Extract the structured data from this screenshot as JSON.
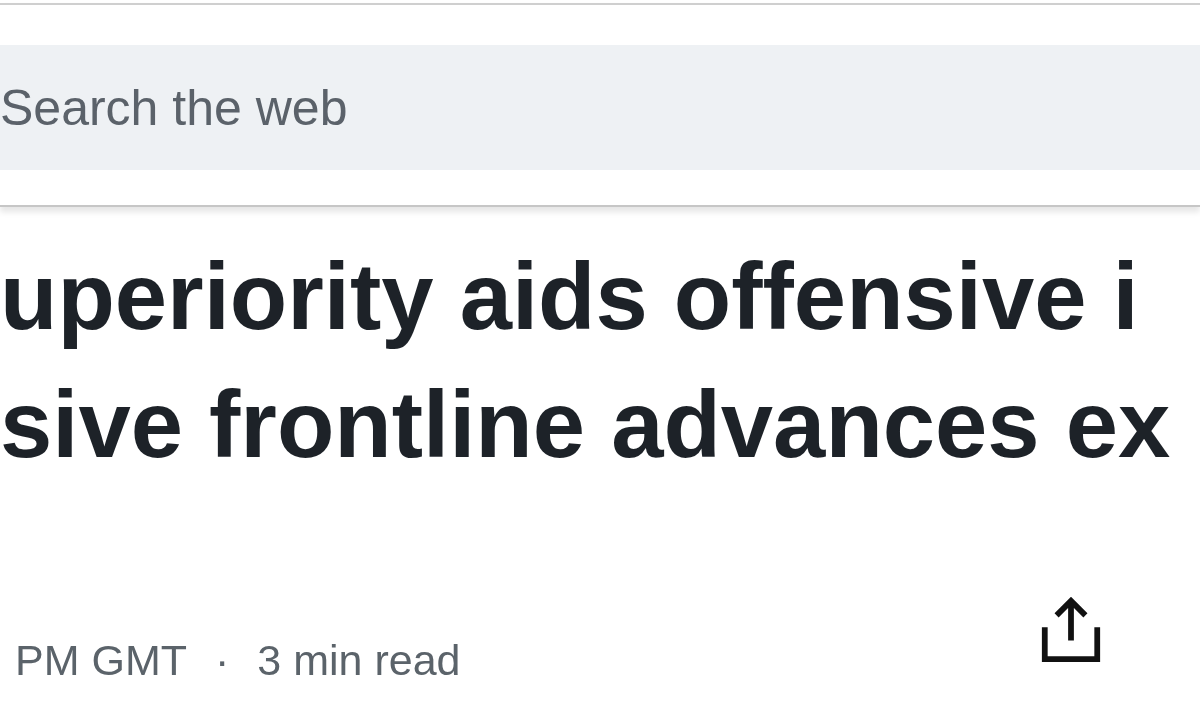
{
  "header": {
    "search": {
      "placeholder": "Search the web"
    }
  },
  "article": {
    "headline_lines": [
      "uperiority aids offensive i",
      "sive frontline advances ex"
    ],
    "meta": {
      "time": "PM GMT",
      "separator": "·",
      "read_time": "3 min read"
    },
    "actions": [
      {
        "kind": "share"
      }
    ]
  }
}
